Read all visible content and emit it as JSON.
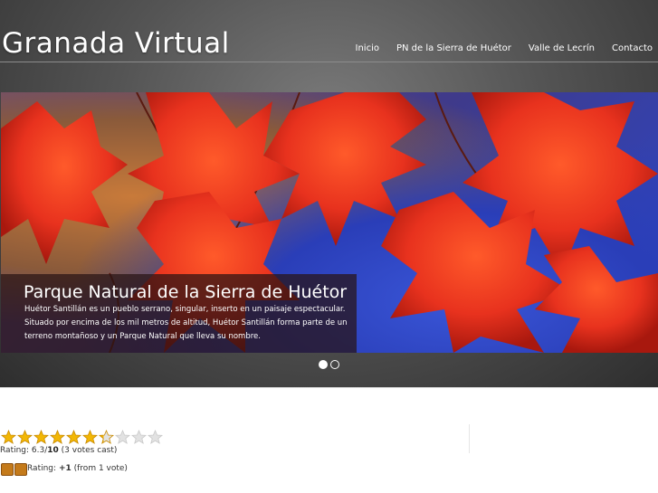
{
  "header": {
    "site_title": "Granada Virtual",
    "nav": [
      "Inicio",
      "PN de la Sierra de Huétor",
      "Valle de Lecrín",
      "Contacto"
    ]
  },
  "slider": {
    "caption_title": "Parque Natural de la Sierra de Huétor",
    "caption_text": "Huétor Santillán es un pueblo serrano, singular, inserto en un paisaje espectacular. Situado por encima de los mil metros de altitud, Huétor Santillán forma parte de un terreno montañoso y un Parque Natural que lleva su nombre.",
    "slides_count": 2,
    "active_slide": 1
  },
  "rating": {
    "stars_total": 10,
    "value": 6.3,
    "label_prefix": "Rating: 6.3/",
    "label_max": "10",
    "label_suffix": "(3 votes cast)"
  },
  "vote": {
    "label_prefix": "Rating:",
    "score": "+1",
    "suffix": "(from 1 vote)"
  },
  "colors": {
    "star_filled": "#f2b705",
    "star_empty": "#e2e2e2",
    "leaf_red": "#e8321e"
  }
}
